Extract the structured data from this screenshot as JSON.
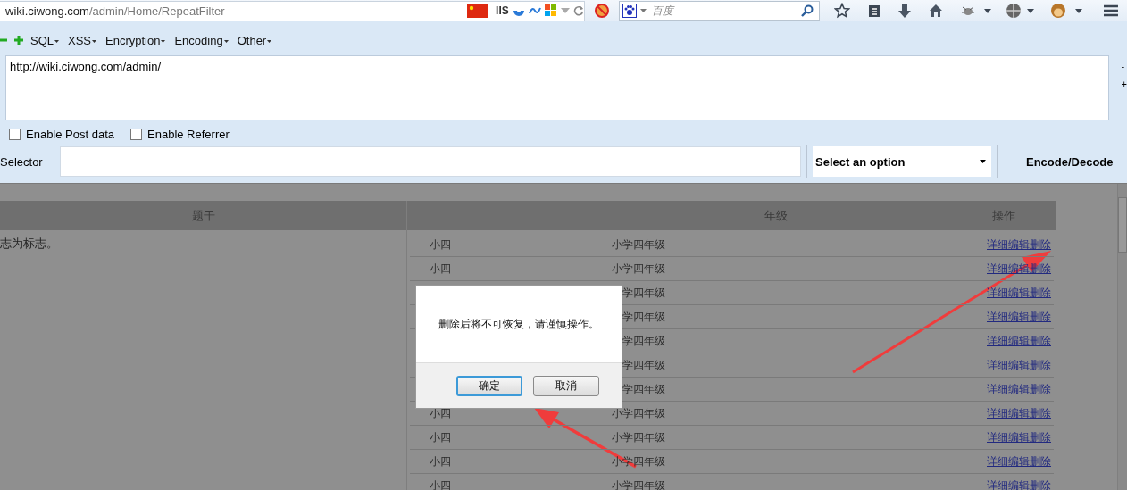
{
  "browser": {
    "url_host": "wiki.ciwong.com",
    "url_path": "/admin/Home/RepeatFilter",
    "addon_label": "IIS",
    "search": {
      "placeholder": "百度"
    }
  },
  "hackbar": {
    "menus": [
      "SQL",
      "XSS",
      "Encryption",
      "Encoding",
      "Other"
    ],
    "url_text": "http://wiki.ciwong.com/admin/",
    "side_marks": [
      "-",
      "+"
    ],
    "options": [
      {
        "label": "Enable Post data",
        "checked": false
      },
      {
        "label": "Enable Referrer",
        "checked": false
      }
    ],
    "selector_label": "Selector",
    "select": {
      "value": "Select an option"
    },
    "encode_label": "Encode/Decode"
  },
  "table": {
    "columns": [
      "题干",
      "年级",
      "操作"
    ],
    "stem_text": "志为标志。",
    "rows": [
      {
        "level": "小四",
        "grade": "小学四年级",
        "actions": [
          "详细",
          "编辑",
          "删除"
        ]
      },
      {
        "level": "小四",
        "grade": "小学四年级",
        "actions": [
          "详细",
          "编辑",
          "删除"
        ]
      },
      {
        "grade": "学四年级",
        "actions": [
          "详细",
          "编辑",
          "删除"
        ]
      },
      {
        "grade": "学四年级",
        "actions": [
          "详细",
          "编辑",
          "删除"
        ]
      },
      {
        "grade": "学四年级",
        "actions": [
          "详细",
          "编辑",
          "删除"
        ]
      },
      {
        "grade": "学四年级",
        "actions": [
          "详细",
          "编辑",
          "删除"
        ]
      },
      {
        "grade": "学四年级",
        "actions": [
          "详细",
          "编辑",
          "删除"
        ]
      },
      {
        "level": "小四",
        "grade": "小学四年级",
        "actions": [
          "详细",
          "编辑",
          "删除"
        ]
      },
      {
        "level": "小四",
        "grade": "小学四年级",
        "actions": [
          "详细",
          "编辑",
          "删除"
        ]
      },
      {
        "level": "小四",
        "grade": "小学四年级",
        "actions": [
          "详细",
          "编辑",
          "删除"
        ]
      },
      {
        "level": "小四",
        "grade": "小学四年级",
        "actions": [
          "详细",
          "编辑",
          "删除"
        ]
      }
    ]
  },
  "dialog": {
    "message": "删除后将不可恢复，请谨慎操作。",
    "buttons": [
      {
        "label": "确定",
        "focused": true
      },
      {
        "label": "取消",
        "focused": false
      }
    ]
  }
}
